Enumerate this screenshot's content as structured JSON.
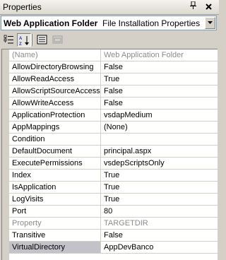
{
  "window": {
    "title": "Properties",
    "pin_glyph": "⬾",
    "close_glyph": "×"
  },
  "object_selector": {
    "name": "Web Application Folder",
    "type": "File Installation Properties"
  },
  "toolbar": {
    "buttons": [
      "categorized-icon",
      "alphabetical-icon",
      "properties-icon",
      "property-pages-icon"
    ]
  },
  "properties": [
    {
      "name": "(Name)",
      "value": "Web Application Folder",
      "disabled": true
    },
    {
      "name": "AllowDirectoryBrowsing",
      "value": "False"
    },
    {
      "name": "AllowReadAccess",
      "value": "True"
    },
    {
      "name": "AllowScriptSourceAccess",
      "value": "False"
    },
    {
      "name": "AllowWriteAccess",
      "value": "False"
    },
    {
      "name": "ApplicationProtection",
      "value": "vsdapMedium"
    },
    {
      "name": "AppMappings",
      "value": "(None)"
    },
    {
      "name": "Condition",
      "value": ""
    },
    {
      "name": "DefaultDocument",
      "value": "principal.aspx"
    },
    {
      "name": "ExecutePermissions",
      "value": "vsdepScriptsOnly"
    },
    {
      "name": "Index",
      "value": "True"
    },
    {
      "name": "IsApplication",
      "value": "True"
    },
    {
      "name": "LogVisits",
      "value": "True"
    },
    {
      "name": "Port",
      "value": "80"
    },
    {
      "name": "Property",
      "value": "TARGETDIR",
      "disabled": true
    },
    {
      "name": "Transitive",
      "value": "False"
    },
    {
      "name": "VirtualDirectory",
      "value": "AppDevBanco",
      "selected": true
    }
  ]
}
